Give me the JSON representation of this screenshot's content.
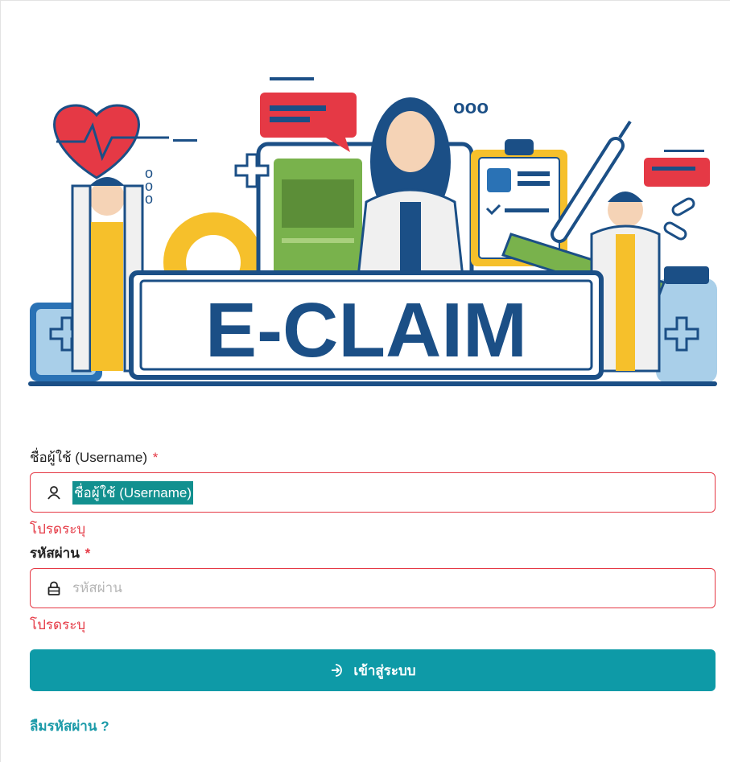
{
  "banner": {
    "logo_text": "E-CLAIM",
    "dots_text": "ooo"
  },
  "form": {
    "username": {
      "label": "ชื่อผู้ใช้ (Username)",
      "required_mark": "*",
      "placeholder": "ชื่อผู้ใช้ (Username)",
      "value_selected": "ชื่อผู้ใช้ (Username)",
      "error": "โปรดระบุ",
      "icon": "user-icon"
    },
    "password": {
      "label": "รหัสผ่าน",
      "required_mark": "*",
      "placeholder": "รหัสผ่าน",
      "value": "",
      "error": "โปรดระบุ",
      "icon": "lock-icon"
    },
    "login_button": {
      "label": "เข้าสู่ระบบ",
      "icon": "login-icon"
    },
    "forgot_password": "ลืมรหัสผ่าน ?"
  },
  "colors": {
    "primary": "#0e9aa7",
    "error": "#e53945",
    "selection": "#12908f",
    "navy": "#1b4f86"
  }
}
